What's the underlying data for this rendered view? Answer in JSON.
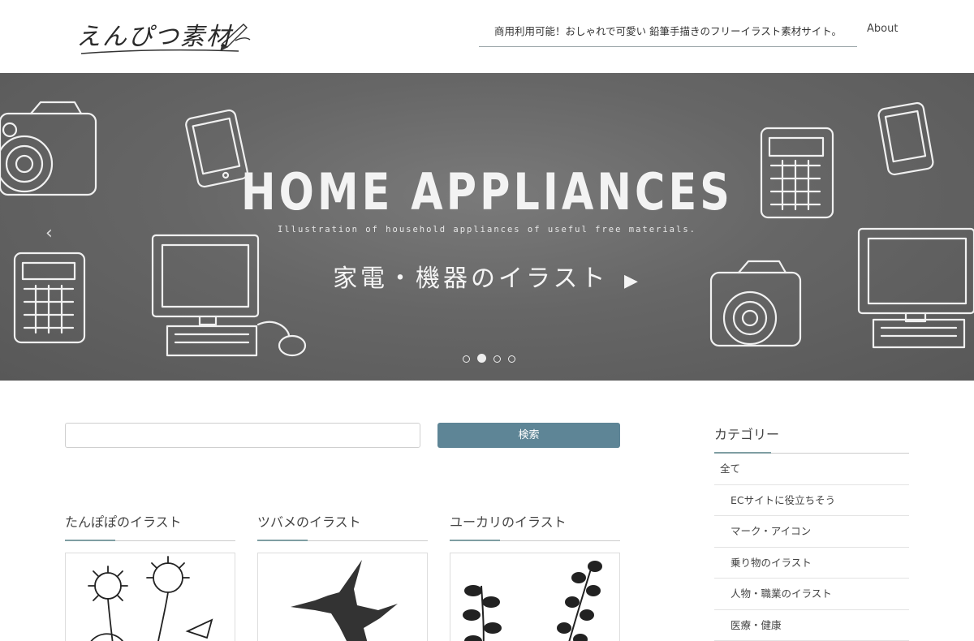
{
  "header": {
    "logo_text": "えんぴつ素材",
    "tagline": "商用利用可能！おしゃれで可愛い 鉛筆手描きのフリーイラスト素材サイト。",
    "nav_about": "About"
  },
  "hero": {
    "title": "HOME APPLIANCES",
    "subtitle": "Illustration of household appliances of useful free materials.",
    "jp_label": "家電・機器のイラスト",
    "arrow": "▶",
    "prev_icon": "‹",
    "slide_count": 4,
    "active_slide": 2,
    "background_color": "#666666"
  },
  "search": {
    "placeholder": "",
    "button_label": "検索",
    "button_color": "#5e8596"
  },
  "cards": [
    {
      "title": "たんぽぽのイラスト"
    },
    {
      "title": "ツバメのイラスト"
    },
    {
      "title": "ユーカリのイラスト"
    }
  ],
  "sidebar": {
    "title": "カテゴリー",
    "items": [
      {
        "label": "全て"
      },
      {
        "label": "ECサイトに役立ちそう"
      },
      {
        "label": "マーク・アイコン"
      },
      {
        "label": "乗り物のイラスト"
      },
      {
        "label": "人物・職業のイラスト"
      },
      {
        "label": "医療・健康"
      }
    ]
  },
  "accent_color": "#7f9ea3"
}
